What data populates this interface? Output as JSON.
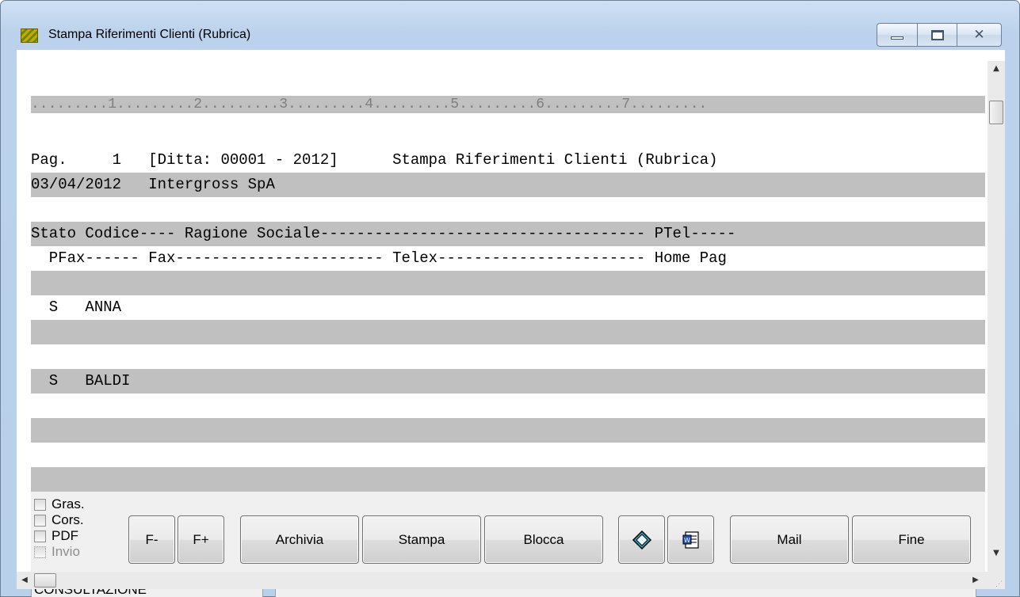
{
  "window": {
    "title": "Stampa Riferimenti Clienti (Rubrica)",
    "icon": "app-icon"
  },
  "report": {
    "ruler": ".........1.........2.........3.........4.........5.........6.........7.........",
    "lines": [
      "Pag.     1   [Ditta: 00001 - 2012]      Stampa Riferimenti Clienti (Rubrica)",
      "03/04/2012   Intergross SpA",
      "",
      "Stato Codice---- Ragione Sociale------------------------------------ PTel-----",
      "  PFax------ Fax----------------------- Telex----------------------- Home Pag",
      "",
      "  S   ANNA",
      "",
      "",
      "  S   BALDI",
      "",
      "",
      "",
      "",
      "",
      ""
    ]
  },
  "options": {
    "gras": "Gras.",
    "cors": "Cors.",
    "pdf": "PDF",
    "invio": "Invio"
  },
  "buttons": {
    "font_minus": "F-",
    "font_plus": "F+",
    "archivia": "Archivia",
    "stampa": "Stampa",
    "blocca": "Blocca",
    "mail": "Mail",
    "fine": "Fine"
  },
  "status": {
    "mode": "CONSULTAZIONE",
    "message": ""
  }
}
